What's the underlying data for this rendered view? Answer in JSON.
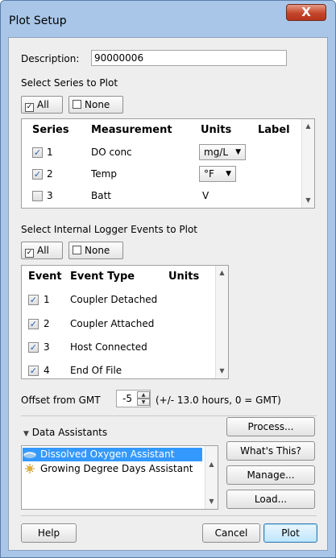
{
  "window": {
    "title": "Plot Setup",
    "close_glyph": "X"
  },
  "description": {
    "label": "Description:",
    "value": "90000006"
  },
  "series_section": {
    "label": "Select Series to Plot",
    "all_label": "All",
    "none_label": "None",
    "headers": [
      "Series",
      "Measurement",
      "Units",
      "Label"
    ],
    "rows": [
      {
        "checked": true,
        "num": "1",
        "measurement": "DO conc",
        "units": "mg/L",
        "units_dropdown": true
      },
      {
        "checked": true,
        "num": "2",
        "measurement": "Temp",
        "units": "°F",
        "units_dropdown": true
      },
      {
        "checked": false,
        "num": "3",
        "measurement": "Batt",
        "units": "V",
        "units_dropdown": false
      }
    ]
  },
  "events_section": {
    "label": "Select Internal Logger Events to Plot",
    "all_label": "All",
    "none_label": "None",
    "headers": [
      "Event",
      "Event Type",
      "Units"
    ],
    "rows": [
      {
        "checked": true,
        "num": "1",
        "type": "Coupler Detached"
      },
      {
        "checked": true,
        "num": "2",
        "type": "Coupler Attached"
      },
      {
        "checked": true,
        "num": "3",
        "type": "Host Connected"
      },
      {
        "checked": true,
        "num": "4",
        "type": "End Of File"
      }
    ]
  },
  "offset": {
    "label": "Offset from GMT",
    "value": "-5",
    "hint": "(+/- 13.0 hours, 0 = GMT)"
  },
  "assistants": {
    "label": "Data Assistants",
    "items": [
      {
        "name": "Dissolved Oxygen Assistant",
        "selected": true,
        "icon": "dissolved-oxygen-icon"
      },
      {
        "name": "Growing Degree Days Assistant",
        "selected": false,
        "icon": "sun-icon"
      }
    ],
    "buttons": {
      "process": "Process...",
      "whats_this": "What's This?",
      "manage": "Manage...",
      "load": "Load..."
    }
  },
  "footer": {
    "help": "Help",
    "cancel": "Cancel",
    "plot": "Plot"
  },
  "colors": {
    "selection": "#3399ff",
    "window_frame": "#a9c6e8",
    "close_button": "#c4452b"
  }
}
